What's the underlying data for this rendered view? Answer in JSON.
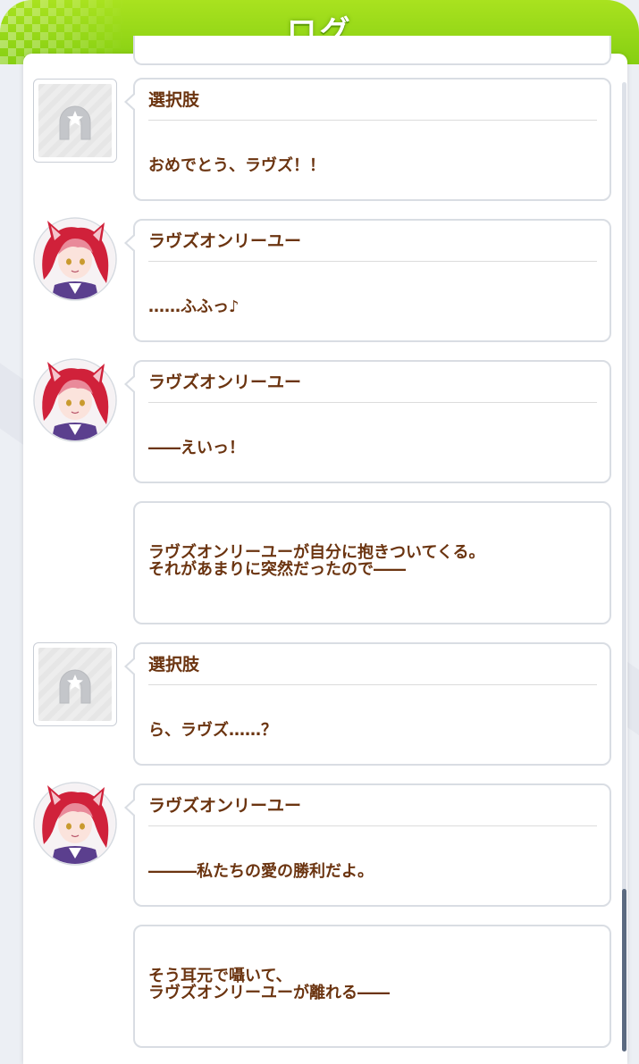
{
  "header": {
    "title": "ログ"
  },
  "entries": [
    {
      "type": "choice",
      "speaker": "選択肢",
      "text": "おめでとう、ラヴズ！！"
    },
    {
      "type": "character",
      "speaker": "ラヴズオンリーユー",
      "text": "……ふふっ♪"
    },
    {
      "type": "character",
      "speaker": "ラヴズオンリーユー",
      "text": "――えいっ！"
    },
    {
      "type": "narration",
      "text": "ラヴズオンリーユーが自分に抱きついてくる。\nそれがあまりに突然だったので――"
    },
    {
      "type": "choice",
      "speaker": "選択肢",
      "text": "ら、ラヴズ……？"
    },
    {
      "type": "character",
      "speaker": "ラヴズオンリーユー",
      "text": "―――私たちの愛の勝利だよ。"
    },
    {
      "type": "narration",
      "text": "そう耳元で囁いて、\nラヴズオンリーユーが離れる――"
    }
  ],
  "icons": {
    "choice_avatar": "horseshoe-star-icon",
    "character_avatar": "character-portrait"
  },
  "colors": {
    "header": "#92d616",
    "text": "#6b3410",
    "hair": "#d0213a"
  }
}
